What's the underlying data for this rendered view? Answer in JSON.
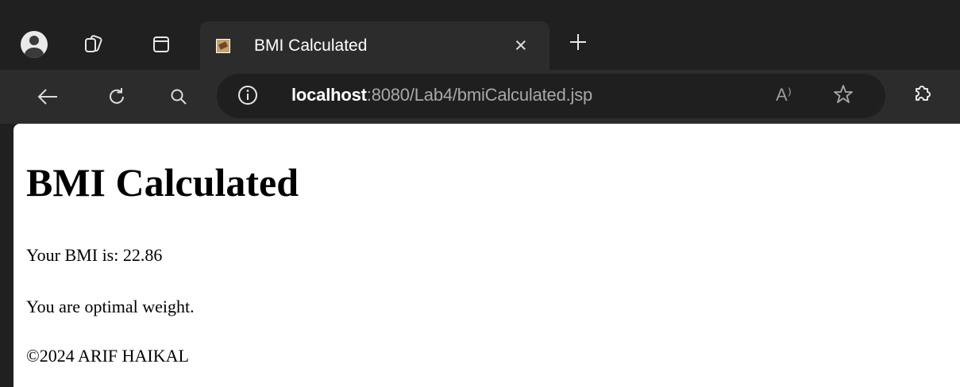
{
  "browser": {
    "tab": {
      "title": "BMI Calculated",
      "close_glyph": "×"
    },
    "new_tab_glyph": "+",
    "address": {
      "host": "localhost",
      "path": ":8080/Lab4/bmiCalculated.jsp"
    },
    "read_aloud_glyph": "A⁾",
    "icons": [
      "profile-icon",
      "workspaces-icon",
      "tab-actions-icon",
      "favicon",
      "close-icon",
      "new-tab-icon",
      "back-icon",
      "refresh-icon",
      "search-icon",
      "site-info-icon",
      "read-aloud-icon",
      "favorite-icon",
      "extensions-icon"
    ]
  },
  "page": {
    "heading": "BMI Calculated",
    "bmi_line": "Your BMI is: 22.86",
    "status_line": "You are optimal weight.",
    "footer": "©2024 ARIF HAIKAL"
  },
  "colors": {
    "chrome_dark": "#202020",
    "toolbar": "#2c2c2c",
    "omnibox": "#1f1f1f",
    "page_bg": "#ffffff"
  }
}
